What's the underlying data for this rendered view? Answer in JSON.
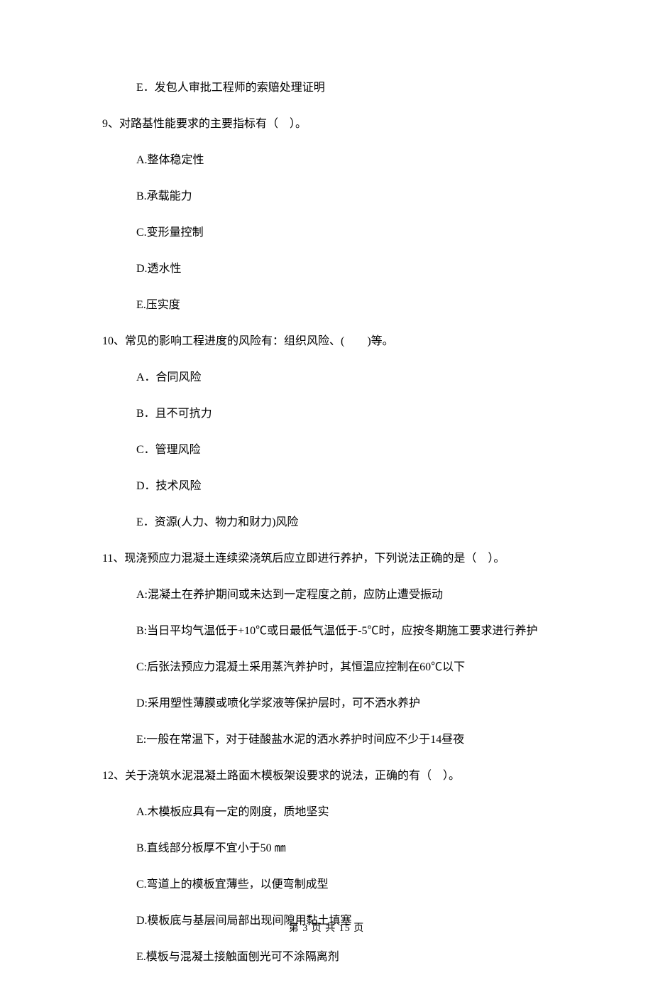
{
  "prev": {
    "option_e": "E．发包人审批工程师的索赔处理证明"
  },
  "q9": {
    "stem": "9、对路基性能要求的主要指标有（　）。",
    "a": "A.整体稳定性",
    "b": "B.承载能力",
    "c": "C.变形量控制",
    "d": "D.透水性",
    "e": "E.压实度"
  },
  "q10": {
    "stem": "10、常见的影响工程进度的风险有：组织风险、(　　)等。",
    "a": "A．合同风险",
    "b": "B．且不可抗力",
    "c": "C．管理风险",
    "d": "D．技术风险",
    "e": "E．资源(人力、物力和财力)风险"
  },
  "q11": {
    "stem": "11、现浇预应力混凝土连续梁浇筑后应立即进行养护，下列说法正确的是（　）。",
    "a": "A:混凝土在养护期间或未达到一定程度之前，应防止遭受振动",
    "b": "B:当日平均气温低于+10℃或日最低气温低于-5℃时，应按冬期施工要求进行养护",
    "c": "C:后张法预应力混凝土采用蒸汽养护时，其恒温应控制在60℃以下",
    "d": "D:采用塑性薄膜或喷化学浆液等保护层时，可不洒水养护",
    "e": "E:一般在常温下，对于硅酸盐水泥的洒水养护时间应不少于14昼夜"
  },
  "q12": {
    "stem": "12、关于浇筑水泥混凝土路面木模板架设要求的说法，正确的有（　）。",
    "a": "A.木模板应具有一定的刚度，质地坚实",
    "b": "B.直线部分板厚不宜小于50 ㎜",
    "c": "C.弯道上的模板宜薄些，以便弯制成型",
    "d": "D.模板底与基层间局部出现间隙用黏土填塞",
    "e": "E.模板与混凝土接触面刨光可不涂隔离剂"
  },
  "footer": "第 3 页 共 15 页"
}
